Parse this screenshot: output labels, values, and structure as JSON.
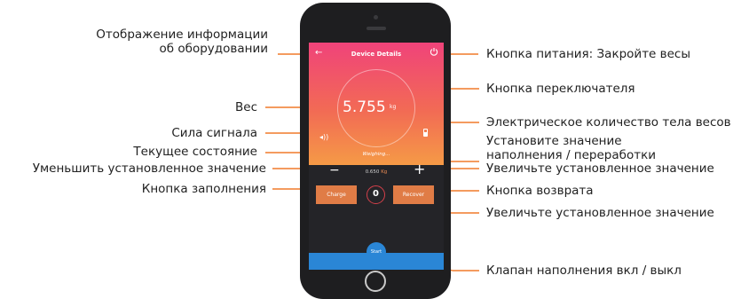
{
  "annotations": {
    "device_info": [
      "Отображение информации",
      "об оборудовании"
    ],
    "weight": "Вес",
    "signal": "Сила сигнала",
    "current_state": "Текущее состояние",
    "decrease": "Уменьшить установленное значение",
    "charge_button": "Кнопка заполнения",
    "power_button": "Кнопка питания: Закройте весы",
    "switch_button": "Кнопка переключателя",
    "battery": "Электрическое количество тела весов",
    "set_value": [
      "Установите значение",
      "наполнения / переработки"
    ],
    "increase": "Увеличьте установленное значение",
    "recover_button": "Кнопка возврата",
    "counter": "Увеличьте установленное значение",
    "valve": "Клапан наполнения вкл / выкл"
  },
  "app": {
    "title": "Device Details",
    "weight_value": "5.755",
    "weight_unit": "kg",
    "status": "Weighing...",
    "set_value": "0.650",
    "set_value_unit": "Kg",
    "minus_label": "−",
    "plus_label": "+",
    "charge_label": "Charge",
    "recover_label": "Recover",
    "counter_value": "0",
    "start_label": "Start"
  },
  "colors": {
    "gradient_top": "#f0437a",
    "gradient_bottom": "#f59a46",
    "button_orange": "#e07c46",
    "start_blue": "#2a86d6",
    "callout_line": "#f07a2a"
  },
  "icons": [
    "back-arrow-icon",
    "power-icon",
    "signal-icon",
    "battery-icon"
  ]
}
